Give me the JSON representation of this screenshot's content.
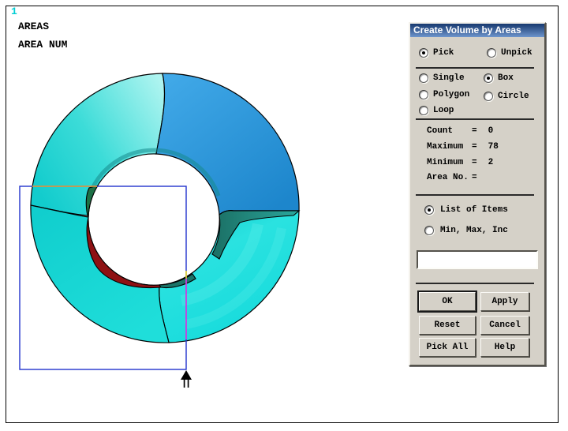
{
  "graphics": {
    "plot_id": "1",
    "annotation_line1": "AREAS",
    "annotation_line2": "AREA NUM",
    "colors": {
      "cyan_lower_right": "#17dbdc",
      "cyan_lower_left": "#16d2d2",
      "blue_segment": "#2e9de2",
      "inner_wall_red": "#8e1113",
      "cut_face_green": "#1d7046",
      "cut_face_teal": "#1b6f64",
      "inner_edge_band": "#168a8c",
      "rubber_band_blue": "#2233cc",
      "band_over_cyan_top": "#f0a030",
      "band_over_cyan_right": "#e23ae2",
      "band_over_teal": "#e8d52a",
      "cursor_black": "#000000"
    }
  },
  "dialog": {
    "title": "Create Volume by Areas",
    "pick_options": [
      {
        "label": "Pick",
        "selected": true
      },
      {
        "label": "Unpick",
        "selected": false
      }
    ],
    "mode_options": [
      {
        "label": "Single",
        "selected": false
      },
      {
        "label": "Box",
        "selected": true
      },
      {
        "label": "Polygon",
        "selected": false
      },
      {
        "label": "Circle",
        "selected": false
      },
      {
        "label": "Loop",
        "selected": false
      }
    ],
    "stats": [
      {
        "label": "Count",
        "eq": "=",
        "value": "0"
      },
      {
        "label": "Maximum",
        "eq": "=",
        "value": "78"
      },
      {
        "label": "Minimum",
        "eq": "=",
        "value": "2"
      },
      {
        "label": "Area No.",
        "eq": "=",
        "value": ""
      }
    ],
    "list_options": [
      {
        "label": "List of Items",
        "selected": true
      },
      {
        "label": "Min, Max, Inc",
        "selected": false
      }
    ],
    "input_value": "",
    "buttons": [
      "OK",
      "Apply",
      "Reset",
      "Cancel",
      "Pick All",
      "Help"
    ]
  }
}
